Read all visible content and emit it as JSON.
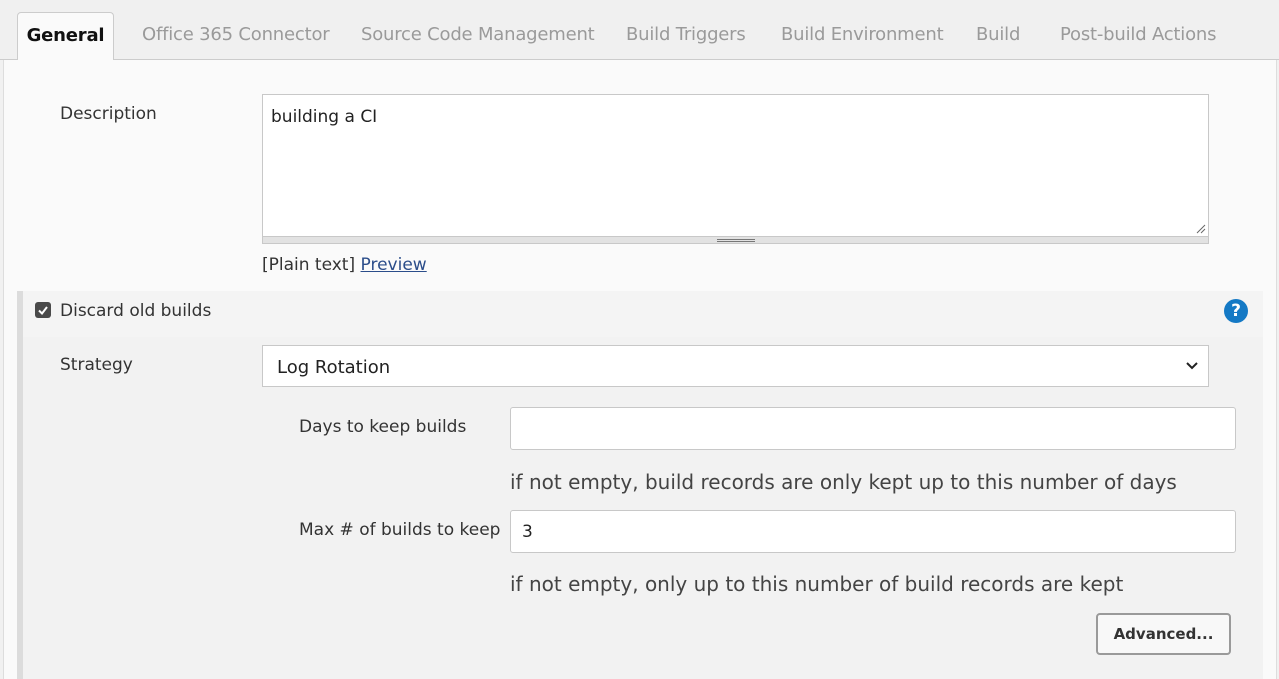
{
  "tabs": [
    {
      "label": "General",
      "active": true
    },
    {
      "label": "Office 365 Connector"
    },
    {
      "label": "Source Code Management"
    },
    {
      "label": "Build Triggers"
    },
    {
      "label": "Build Environment"
    },
    {
      "label": "Build"
    },
    {
      "label": "Post-build Actions"
    }
  ],
  "description": {
    "label": "Description",
    "value": "building a CI",
    "format_text": "[Plain text]",
    "preview_link": "Preview"
  },
  "discard_old_builds": {
    "label": "Discard old builds",
    "checked": true,
    "help_icon": "?",
    "strategy_label": "Strategy",
    "strategy_value": "Log Rotation",
    "days_label": "Days to keep builds",
    "days_value": "",
    "days_hint": "if not empty, build records are only kept up to this number of days",
    "max_label": "Max # of builds to keep",
    "max_value": "3",
    "max_hint": "if not empty, only up to this number of build records are kept",
    "advanced_button": "Advanced..."
  },
  "colors": {
    "accent": "#1479c5",
    "link": "#2b4d8a"
  }
}
